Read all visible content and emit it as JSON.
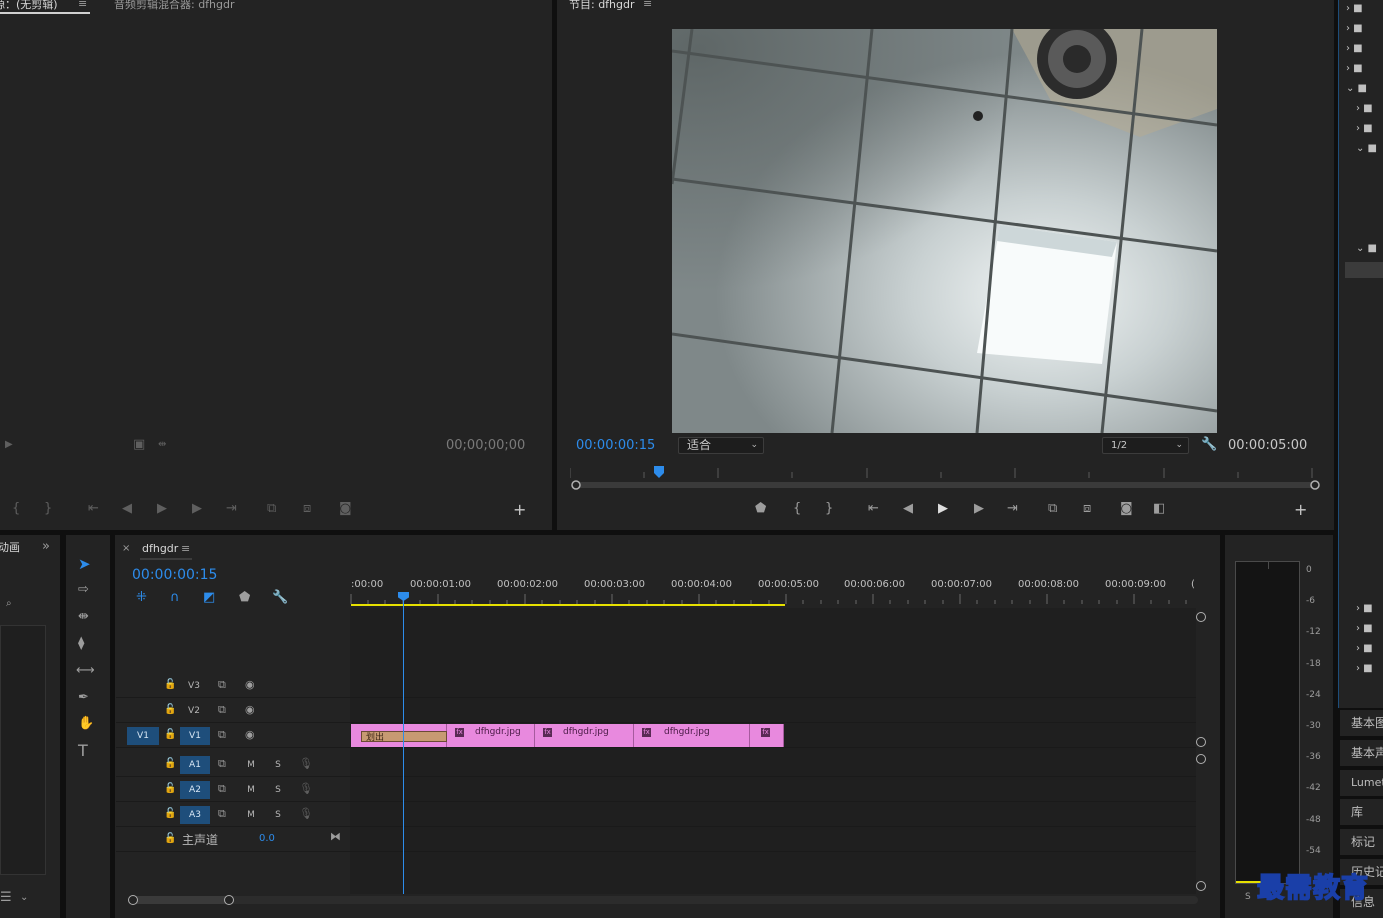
{
  "source_monitor": {
    "tab_active": "源：(无剪辑)",
    "tab_mixer": "音频剪辑混合器: dfhgdr",
    "timecode": "00;00;00;00"
  },
  "program_monitor": {
    "tab": "节目: dfhgdr",
    "timecode_current": "00:00:00:15",
    "fit_select": "适合",
    "resolution_select": "1/2",
    "timecode_duration": "00:00:05:00"
  },
  "project_panel": {
    "tab_partial": "动画"
  },
  "timeline": {
    "sequence_name": "dfhgdr",
    "timecode": "00:00:00:15",
    "ruler_labels": [
      ":00:00",
      "00:00:01:00",
      "00:00:02:00",
      "00:00:03:00",
      "00:00:04:00",
      "00:00:05:00",
      "00:00:06:00",
      "00:00:07:00",
      "00:00:08:00",
      "00:00:09:00",
      "("
    ],
    "video_tracks": [
      {
        "label": "V3"
      },
      {
        "label": "V2"
      },
      {
        "label": "V1",
        "source_patch": "V1"
      }
    ],
    "audio_tracks": [
      {
        "label": "A1",
        "mute": "M",
        "solo": "S"
      },
      {
        "label": "A2",
        "mute": "M",
        "solo": "S"
      },
      {
        "label": "A3",
        "mute": "M",
        "solo": "S"
      }
    ],
    "master": {
      "label": "主声道",
      "value": "0.0"
    },
    "clips": [
      {
        "name": "划出",
        "kind": "transition"
      },
      {
        "name": "dfhgdr.jpg"
      },
      {
        "name": "dfhgdr.jpg"
      },
      {
        "name": "dfhgdr.jpg"
      },
      {
        "name": ""
      }
    ],
    "playhead_fraction": 0.06
  },
  "audio_meter": {
    "labels": [
      "0",
      "-6",
      "-12",
      "-18",
      "-24",
      "-30",
      "-36",
      "-42",
      "-48",
      "-54"
    ],
    "solo_label": "S"
  },
  "right_panels": {
    "buttons": [
      "基本图",
      "基本声",
      "Lumet",
      "库",
      "标记",
      "历史记"
    ],
    "bottom_partial": "信息"
  },
  "watermark": {
    "text": "最需教育"
  },
  "colors": {
    "accent_blue": "#2d8ceb",
    "clip_pink": "#e889de",
    "work_area_yellow": "#e6e000",
    "panel_bg": "#232323"
  }
}
